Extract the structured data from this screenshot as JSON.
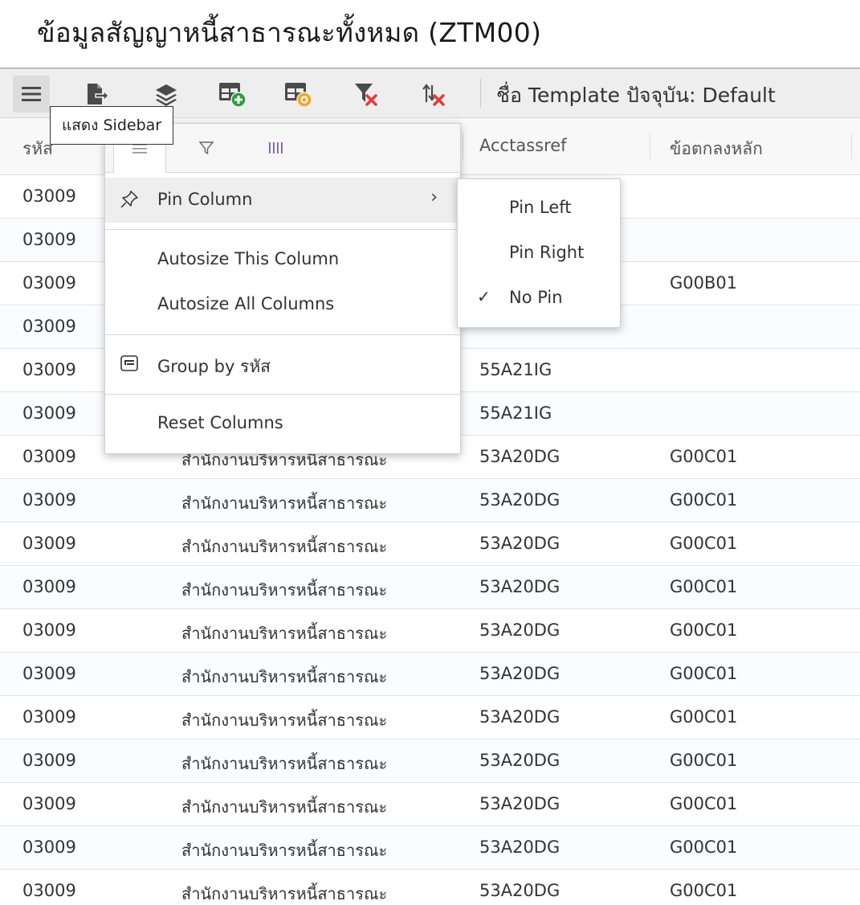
{
  "page_title": "ข้อมูลสัญญาหนี้สาธารณะทั้งหมด (ZTM00)",
  "toolbar": {
    "buttons": [
      {
        "name": "menu-icon"
      },
      {
        "name": "export-icon"
      },
      {
        "name": "layers-icon"
      },
      {
        "name": "add-template-icon"
      },
      {
        "name": "edit-template-icon"
      },
      {
        "name": "clear-filter-icon"
      },
      {
        "name": "clear-sort-icon"
      }
    ],
    "template_label": "ชื่อ Template ปัจจุบัน: Default"
  },
  "tooltip": "แสดง Sidebar",
  "columns": [
    "รหัส",
    "",
    "Acctassref",
    "ข้อตกลงหลัก"
  ],
  "rows": [
    [
      "03009",
      "",
      "",
      ""
    ],
    [
      "03009",
      "",
      "",
      ""
    ],
    [
      "03009",
      "",
      "",
      "G00B01"
    ],
    [
      "03009",
      "",
      "",
      ""
    ],
    [
      "03009",
      "",
      "55A21IG",
      ""
    ],
    [
      "03009",
      "",
      "55A21IG",
      ""
    ],
    [
      "03009",
      "สำนักงานบริหารหนี้สาธารณะ",
      "53A20DG",
      "G00C01"
    ],
    [
      "03009",
      "สำนักงานบริหารหนี้สาธารณะ",
      "53A20DG",
      "G00C01"
    ],
    [
      "03009",
      "สำนักงานบริหารหนี้สาธารณะ",
      "53A20DG",
      "G00C01"
    ],
    [
      "03009",
      "สำนักงานบริหารหนี้สาธารณะ",
      "53A20DG",
      "G00C01"
    ],
    [
      "03009",
      "สำนักงานบริหารหนี้สาธารณะ",
      "53A20DG",
      "G00C01"
    ],
    [
      "03009",
      "สำนักงานบริหารหนี้สาธารณะ",
      "53A20DG",
      "G00C01"
    ],
    [
      "03009",
      "สำนักงานบริหารหนี้สาธารณะ",
      "53A20DG",
      "G00C01"
    ],
    [
      "03009",
      "สำนักงานบริหารหนี้สาธารณะ",
      "53A20DG",
      "G00C01"
    ],
    [
      "03009",
      "สำนักงานบริหารหนี้สาธารณะ",
      "53A20DG",
      "G00C01"
    ],
    [
      "03009",
      "สำนักงานบริหารหนี้สาธารณะ",
      "53A20DG",
      "G00C01"
    ],
    [
      "03009",
      "สำนักงานบริหารหนี้สาธารณะ",
      "53A20DG",
      "G00C01"
    ]
  ],
  "column_menu": {
    "tabs": [
      "general-menu-icon",
      "filter-icon",
      "columns-icon"
    ],
    "items": {
      "pin_column": "Pin Column",
      "autosize_this": "Autosize This Column",
      "autosize_all": "Autosize All Columns",
      "group_by": "Group by รหัส",
      "reset_columns": "Reset Columns"
    },
    "pin_submenu": {
      "pin_left": "Pin Left",
      "pin_right": "Pin Right",
      "no_pin": "No Pin",
      "selected": "no_pin",
      "check_glyph": "✓"
    },
    "arrow_glyph": "›"
  },
  "colors": {
    "accent_green": "#2e9d3a",
    "accent_orange": "#f5a623",
    "accent_red": "#e53935",
    "icon_gray": "#4a4a4a"
  }
}
